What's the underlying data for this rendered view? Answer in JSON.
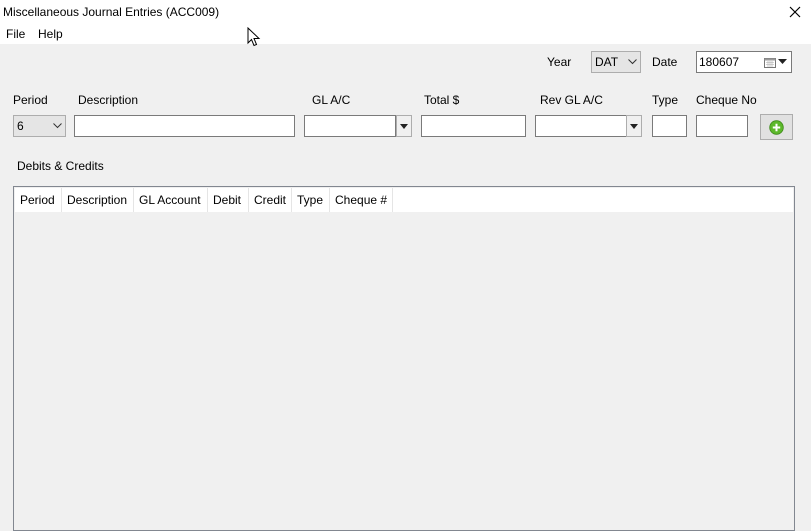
{
  "window": {
    "title": "Miscellaneous Journal Entries (ACC009)"
  },
  "menu": [
    "File",
    "Help"
  ],
  "filters": {
    "year_label": "Year",
    "year_value": "DAT",
    "date_label": "Date",
    "date_value": "180607"
  },
  "form": {
    "period_label": "Period",
    "period_value": "6",
    "description_label": "Description",
    "description_value": "",
    "gl_label": "GL A/C",
    "gl_value": "",
    "total_label": "Total $",
    "total_value": "",
    "rev_gl_label": "Rev GL A/C",
    "rev_gl_value": "",
    "type_label": "Type",
    "type_value": "",
    "cheque_label": "Cheque No",
    "cheque_value": ""
  },
  "section": {
    "title": "Debits & Credits"
  },
  "table": {
    "columns": [
      "Period",
      "Description",
      "GL Account",
      "Debit",
      "Credit",
      "Type",
      "Cheque #"
    ],
    "rows": []
  },
  "colors": {
    "add_icon": "#5cb82a",
    "window_bg": "#f0f0f0"
  },
  "icons": {
    "close": "close-icon",
    "add": "plus-circle-icon",
    "calendar": "calendar-icon"
  }
}
